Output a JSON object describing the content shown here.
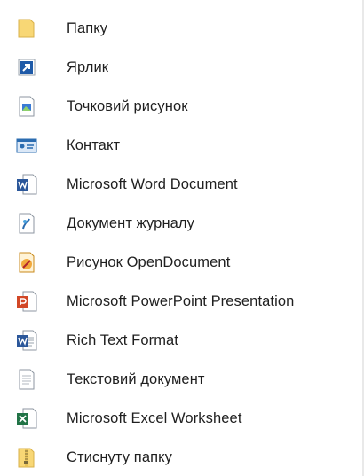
{
  "menu": {
    "items": [
      {
        "label": "Папку",
        "icon": "folder-icon"
      },
      {
        "label": "Ярлик",
        "icon": "shortcut-icon"
      },
      {
        "label": "Точковий рисунок",
        "icon": "bitmap-image-icon"
      },
      {
        "label": "Контакт",
        "icon": "contact-card-icon"
      },
      {
        "label": "Microsoft Word Document",
        "icon": "word-document-icon"
      },
      {
        "label": "Документ журналу",
        "icon": "journal-document-icon"
      },
      {
        "label": "Рисунок OpenDocument",
        "icon": "opendocument-drawing-icon"
      },
      {
        "label": "Microsoft PowerPoint Presentation",
        "icon": "powerpoint-icon"
      },
      {
        "label": "Rich Text Format",
        "icon": "rich-text-document-icon"
      },
      {
        "label": "Текстовий документ",
        "icon": "text-document-icon"
      },
      {
        "label": "Microsoft Excel Worksheet",
        "icon": "excel-worksheet-icon"
      },
      {
        "label": "Стиснуту папку",
        "icon": "zip-folder-icon"
      }
    ]
  },
  "colors": {
    "folder": "#f8d775",
    "word": "#2b579a",
    "powerpoint": "#d24726",
    "excel": "#217346",
    "shortcut": "#1e5aa8"
  }
}
